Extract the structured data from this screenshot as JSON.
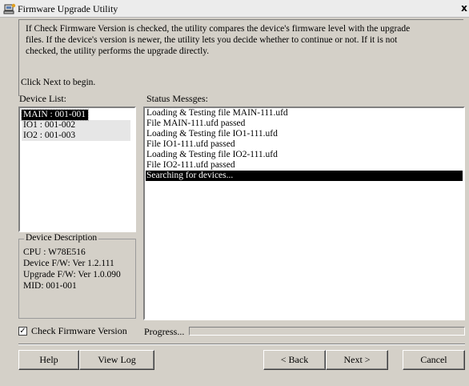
{
  "window": {
    "title": "Firmware Upgrade Utility",
    "close_glyph": "x"
  },
  "intro": {
    "lines": [
      "If Check Firmware Version is checked, the utility compares the device's firmware level with the upgrade",
      "files. If the device's version is newer, the utility lets you decide whether to continue or not. If it is not",
      "checked, the utility performs the upgrade directly."
    ],
    "next_hint": "Click Next to begin."
  },
  "device_list": {
    "label": "Device List:",
    "items": [
      "MAIN : 001-001",
      "IO1 : 001-002",
      "IO2 : 001-003"
    ],
    "selected_index": 0
  },
  "device_description": {
    "legend": "Device Description",
    "lines": [
      "CPU : W78E516",
      "Device F/W: Ver 1.2.111",
      "Upgrade F/W: Ver 1.0.090",
      "MID: 001-001"
    ]
  },
  "status": {
    "label": "Status Messges:",
    "lines": [
      "Loading & Testing file MAIN-111.ufd",
      "File MAIN-111.ufd passed",
      "Loading & Testing file IO1-111.ufd",
      "File IO1-111.ufd passed",
      "Loading & Testing file IO2-111.ufd",
      "File IO2-111.ufd passed",
      "Searching for devices..."
    ],
    "highlight_index": 6
  },
  "check_firmware": {
    "label": "Check Firmware Version",
    "checked": true,
    "check_glyph": "✓"
  },
  "progress": {
    "label": "Progress...",
    "fraction": 0
  },
  "buttons": {
    "help": "Help",
    "view_log": "View Log",
    "back": "< Back",
    "next": "Next >",
    "cancel": "Cancel"
  }
}
